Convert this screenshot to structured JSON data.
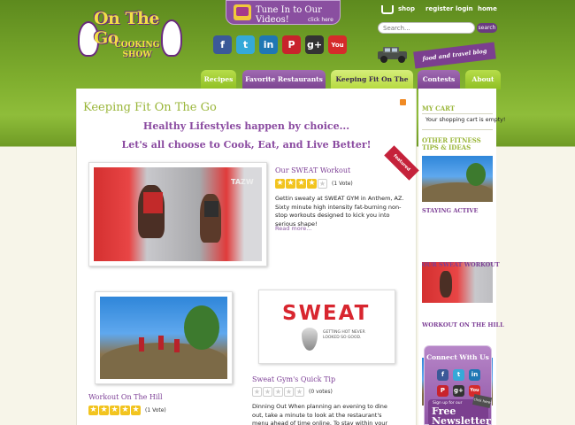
{
  "header": {
    "logo_line1": "On The Go",
    "logo_line2": "COOKING",
    "logo_line3": "SHOW",
    "tune_in": "Tune In to Our Videos!",
    "tune_in_sub": "click here",
    "top_links": [
      "shop",
      "register",
      "login",
      "home"
    ],
    "search_placeholder": "Search...",
    "search_button": "search",
    "banner": "food and travel blog",
    "social": [
      {
        "icon": "facebook-icon",
        "glyph": "f",
        "color": "#3b5998"
      },
      {
        "icon": "twitter-icon",
        "glyph": "t",
        "color": "#35a9d8"
      },
      {
        "icon": "linkedin-icon",
        "glyph": "in",
        "color": "#1f77b4"
      },
      {
        "icon": "pinterest-icon",
        "glyph": "P",
        "color": "#c8232c"
      },
      {
        "icon": "googleplus-icon",
        "glyph": "g+",
        "color": "#333333"
      },
      {
        "icon": "youtube-icon",
        "glyph": "You",
        "color": "#d52b2b"
      }
    ]
  },
  "nav": {
    "tabs": [
      {
        "label": "Recipes",
        "style": "green"
      },
      {
        "label": "Favorite Restaurants",
        "style": "purple"
      },
      {
        "label": "Keeping Fit On The Go",
        "style": "active"
      },
      {
        "label": "Contests",
        "style": "purple"
      },
      {
        "label": "About",
        "style": "green"
      }
    ]
  },
  "main": {
    "page_title": "Keeping Fit On The Go",
    "tagline1": "Healthy Lifestyles happen by choice...",
    "tagline2": "Let's all choose to Cook, Eat, and Live Better!",
    "featured": {
      "title": "Our SWEAT Workout",
      "rating": 4,
      "votes": "(1 Vote)",
      "text": "Gettin sweaty at SWEAT GYM in Anthem, AZ. Sixty minute high intensity fat-burning non-stop workouts designed to kick you into serious shape!",
      "read_more": "Read more...",
      "ribbon": "featured"
    },
    "post2": {
      "title": "Workout On The Hill",
      "rating": 5,
      "votes": "(1 Vote)"
    },
    "post3": {
      "title": "Sweat Gym's Quick Tip",
      "rating": 0,
      "votes": "(0 votes)",
      "text": "Dinning Out When planning an evening to dine out, take a minute to look at the restaurant's menu ahead of time online. To stay within your customized meal plan, look for the healthy options so",
      "logo_word": "SWEAT",
      "logo_small": "GETTING HOT NEVER LOOKED SO GOOD."
    }
  },
  "sidebar": {
    "cart_heading": "MY CART",
    "cart_text": "Your shopping cart is empty!",
    "tips_heading": "OTHER FITNESS TIPS & IDEAS",
    "links": [
      "STAYING ACTIVE",
      "OUR SWEAT WORKOUT",
      "WORKOUT ON THE HILL"
    ],
    "connect_heading": "Connect With Us",
    "newsletter_small": "Sign up for our",
    "newsletter_big": "Free Newsletter",
    "newsletter_tag": "click here"
  }
}
